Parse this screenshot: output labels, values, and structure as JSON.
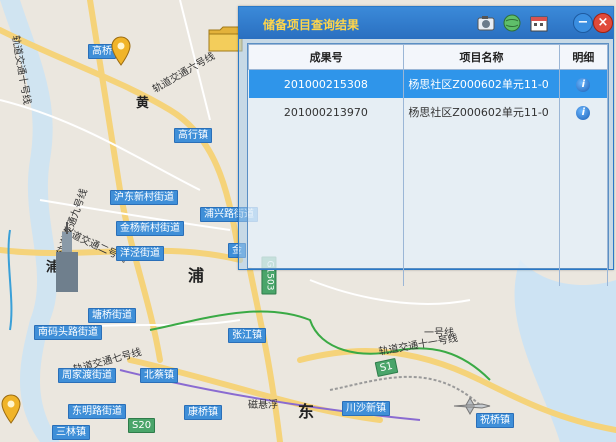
{
  "panel": {
    "title": "储备项目查询结果",
    "columns": [
      "成果号",
      "项目名称",
      "明细"
    ],
    "rows": [
      {
        "id": "201000215308",
        "name": "杨思社区Z000602单元11-0",
        "selected": true
      },
      {
        "id": "201000213970",
        "name": "杨思社区Z000602单元11-0",
        "selected": false
      }
    ],
    "info_icon_text": "i",
    "minimize_glyph": "−",
    "close_glyph": "×"
  },
  "map": {
    "labels": [
      {
        "key": "gaoqiao",
        "text": "高桥"
      },
      {
        "key": "gaohang",
        "text": "高行镇"
      },
      {
        "key": "hudong",
        "text": "沪东新村街道"
      },
      {
        "key": "jinyang",
        "text": "金杨新村街道"
      },
      {
        "key": "puxing",
        "text": "浦兴路街道"
      },
      {
        "key": "yangjing",
        "text": "洋泾街道"
      },
      {
        "key": "jinqiao",
        "text": "金"
      },
      {
        "key": "tangqiao",
        "text": "塘桥街道"
      },
      {
        "key": "nanmatou",
        "text": "南码头路街道"
      },
      {
        "key": "zhangjiang",
        "text": "张江镇"
      },
      {
        "key": "zhoujiadu",
        "text": "周家渡街道"
      },
      {
        "key": "beicai",
        "text": "北蔡镇"
      },
      {
        "key": "dongming",
        "text": "东明路街道"
      },
      {
        "key": "kangqiao",
        "text": "康桥镇"
      },
      {
        "key": "chuansha",
        "text": "川沙新镇"
      },
      {
        "key": "zhuqiao",
        "text": "祝桥镇"
      },
      {
        "key": "sanlin",
        "text": "三林镇"
      },
      {
        "key": "s1",
        "text": "S1"
      },
      {
        "key": "s20",
        "text": "S20"
      },
      {
        "key": "g1503",
        "text": "G1503"
      }
    ],
    "big_text": {
      "huang": "黄",
      "pu": "浦",
      "dong": "东",
      "pu2": "浦"
    },
    "rail_texts": {
      "r1": "轨道交通十号线",
      "r2": "轨道交通六号线",
      "r3": "轨道交通九号线",
      "r4": "轨道交通二号线",
      "r5": "轨道交通七号线",
      "r6": "磁悬浮",
      "r7": "轨道交通十一号线",
      "r8": "一号线"
    }
  }
}
